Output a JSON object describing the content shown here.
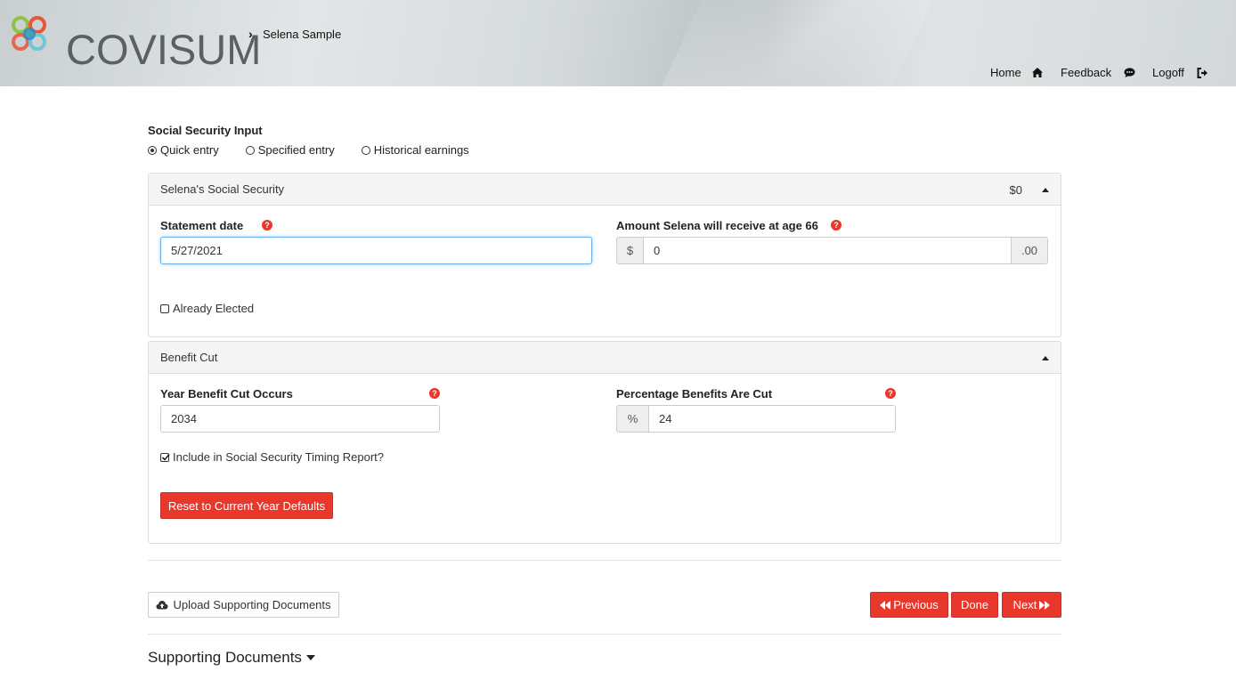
{
  "header": {
    "brand": "COVISUM",
    "breadcrumb_client": "Selena Sample",
    "nav": {
      "home": "Home",
      "feedback": "Feedback",
      "logoff": "Logoff"
    }
  },
  "input_mode": {
    "title": "Social Security Input",
    "options": [
      "Quick entry",
      "Specified entry",
      "Historical earnings"
    ],
    "selected": "Quick entry"
  },
  "social_security_panel": {
    "heading": "Selena's Social Security",
    "total": "$0",
    "statement_date_label": "Statement date",
    "statement_date_value": "5/27/2021",
    "amount_label": "Amount Selena will receive at age 66",
    "amount_prefix": "$",
    "amount_value": "0",
    "amount_suffix": ".00",
    "already_elected_label": "Already Elected",
    "already_elected_checked": false
  },
  "benefit_cut_panel": {
    "heading": "Benefit Cut",
    "year_label": "Year Benefit Cut Occurs",
    "year_value": "2034",
    "percent_label": "Percentage Benefits Are Cut",
    "percent_prefix": "%",
    "percent_value": "24",
    "include_label": "Include in Social Security Timing Report?",
    "include_checked": true,
    "reset_button": "Reset to Current Year Defaults"
  },
  "actions": {
    "upload": "Upload Supporting Documents",
    "previous": "Previous",
    "done": "Done",
    "next": "Next"
  },
  "supporting_documents": {
    "title": "Supporting Documents"
  },
  "colors": {
    "accent_red": "#e8382c",
    "focus_blue": "#66afe9",
    "logo_circles": [
      "#8bc34a",
      "#e8563a",
      "#2a8cc4",
      "#6ec6d8",
      "#f39c5a",
      "#4aa3b5"
    ]
  }
}
